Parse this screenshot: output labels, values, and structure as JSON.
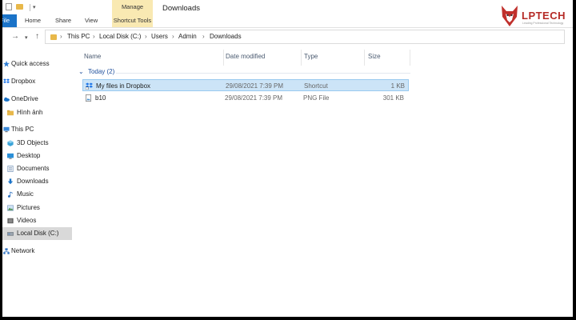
{
  "window": {
    "title": "Downloads"
  },
  "ribbon": {
    "context_group": "Manage",
    "file_tab": "File",
    "tabs": [
      "Home",
      "Share",
      "View"
    ],
    "context_tab": "Shortcut Tools"
  },
  "breadcrumb": [
    "This PC",
    "Local Disk (C:)",
    "Users",
    "Admin",
    "Downloads"
  ],
  "sidebar": {
    "items": [
      {
        "label": "Quick access",
        "icon": "star-icon"
      },
      {
        "label": "Dropbox",
        "icon": "dropbox-icon"
      },
      {
        "label": "OneDrive",
        "icon": "cloud-icon"
      },
      {
        "label": "Hình ảnh",
        "icon": "folder-icon"
      },
      {
        "label": "This PC",
        "icon": "computer-icon"
      },
      {
        "label": "3D Objects",
        "icon": "cube-icon"
      },
      {
        "label": "Desktop",
        "icon": "desktop-icon"
      },
      {
        "label": "Documents",
        "icon": "documents-icon"
      },
      {
        "label": "Downloads",
        "icon": "download-icon"
      },
      {
        "label": "Music",
        "icon": "music-icon"
      },
      {
        "label": "Pictures",
        "icon": "pictures-icon"
      },
      {
        "label": "Videos",
        "icon": "videos-icon"
      },
      {
        "label": "Local Disk (C:)",
        "icon": "drive-icon"
      },
      {
        "label": "Network",
        "icon": "network-icon"
      }
    ],
    "selected": "Local Disk (C:)"
  },
  "list": {
    "columns": [
      "Name",
      "Date modified",
      "Type",
      "Size"
    ],
    "group": "Today (2)",
    "rows": [
      {
        "name": "My files in Dropbox",
        "date": "29/08/2021 7:39 PM",
        "type": "Shortcut",
        "size": "1 KB",
        "icon": "shortcut-icon"
      },
      {
        "name": "b10",
        "date": "29/08/2021 7:39 PM",
        "type": "PNG File",
        "size": "301 KB",
        "icon": "image-file-icon"
      }
    ],
    "selected_row": "My files in Dropbox"
  },
  "logo": {
    "name": "LPTECH",
    "tagline": "Leading Professional Technology"
  },
  "colors": {
    "accent": "#1a73c8",
    "context": "#f9e9b2",
    "selection": "#cce4f7",
    "logo": "#b52a26"
  }
}
